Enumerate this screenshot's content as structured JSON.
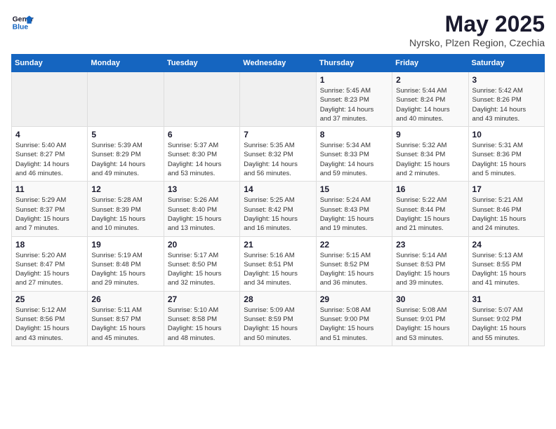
{
  "logo": {
    "line1": "General",
    "line2": "Blue"
  },
  "title": "May 2025",
  "subtitle": "Nyrsko, Plzen Region, Czechia",
  "weekdays": [
    "Sunday",
    "Monday",
    "Tuesday",
    "Wednesday",
    "Thursday",
    "Friday",
    "Saturday"
  ],
  "weeks": [
    [
      {
        "day": "",
        "info": ""
      },
      {
        "day": "",
        "info": ""
      },
      {
        "day": "",
        "info": ""
      },
      {
        "day": "",
        "info": ""
      },
      {
        "day": "1",
        "info": "Sunrise: 5:45 AM\nSunset: 8:23 PM\nDaylight: 14 hours\nand 37 minutes."
      },
      {
        "day": "2",
        "info": "Sunrise: 5:44 AM\nSunset: 8:24 PM\nDaylight: 14 hours\nand 40 minutes."
      },
      {
        "day": "3",
        "info": "Sunrise: 5:42 AM\nSunset: 8:26 PM\nDaylight: 14 hours\nand 43 minutes."
      }
    ],
    [
      {
        "day": "4",
        "info": "Sunrise: 5:40 AM\nSunset: 8:27 PM\nDaylight: 14 hours\nand 46 minutes."
      },
      {
        "day": "5",
        "info": "Sunrise: 5:39 AM\nSunset: 8:29 PM\nDaylight: 14 hours\nand 49 minutes."
      },
      {
        "day": "6",
        "info": "Sunrise: 5:37 AM\nSunset: 8:30 PM\nDaylight: 14 hours\nand 53 minutes."
      },
      {
        "day": "7",
        "info": "Sunrise: 5:35 AM\nSunset: 8:32 PM\nDaylight: 14 hours\nand 56 minutes."
      },
      {
        "day": "8",
        "info": "Sunrise: 5:34 AM\nSunset: 8:33 PM\nDaylight: 14 hours\nand 59 minutes."
      },
      {
        "day": "9",
        "info": "Sunrise: 5:32 AM\nSunset: 8:34 PM\nDaylight: 15 hours\nand 2 minutes."
      },
      {
        "day": "10",
        "info": "Sunrise: 5:31 AM\nSunset: 8:36 PM\nDaylight: 15 hours\nand 5 minutes."
      }
    ],
    [
      {
        "day": "11",
        "info": "Sunrise: 5:29 AM\nSunset: 8:37 PM\nDaylight: 15 hours\nand 7 minutes."
      },
      {
        "day": "12",
        "info": "Sunrise: 5:28 AM\nSunset: 8:39 PM\nDaylight: 15 hours\nand 10 minutes."
      },
      {
        "day": "13",
        "info": "Sunrise: 5:26 AM\nSunset: 8:40 PM\nDaylight: 15 hours\nand 13 minutes."
      },
      {
        "day": "14",
        "info": "Sunrise: 5:25 AM\nSunset: 8:42 PM\nDaylight: 15 hours\nand 16 minutes."
      },
      {
        "day": "15",
        "info": "Sunrise: 5:24 AM\nSunset: 8:43 PM\nDaylight: 15 hours\nand 19 minutes."
      },
      {
        "day": "16",
        "info": "Sunrise: 5:22 AM\nSunset: 8:44 PM\nDaylight: 15 hours\nand 21 minutes."
      },
      {
        "day": "17",
        "info": "Sunrise: 5:21 AM\nSunset: 8:46 PM\nDaylight: 15 hours\nand 24 minutes."
      }
    ],
    [
      {
        "day": "18",
        "info": "Sunrise: 5:20 AM\nSunset: 8:47 PM\nDaylight: 15 hours\nand 27 minutes."
      },
      {
        "day": "19",
        "info": "Sunrise: 5:19 AM\nSunset: 8:48 PM\nDaylight: 15 hours\nand 29 minutes."
      },
      {
        "day": "20",
        "info": "Sunrise: 5:17 AM\nSunset: 8:50 PM\nDaylight: 15 hours\nand 32 minutes."
      },
      {
        "day": "21",
        "info": "Sunrise: 5:16 AM\nSunset: 8:51 PM\nDaylight: 15 hours\nand 34 minutes."
      },
      {
        "day": "22",
        "info": "Sunrise: 5:15 AM\nSunset: 8:52 PM\nDaylight: 15 hours\nand 36 minutes."
      },
      {
        "day": "23",
        "info": "Sunrise: 5:14 AM\nSunset: 8:53 PM\nDaylight: 15 hours\nand 39 minutes."
      },
      {
        "day": "24",
        "info": "Sunrise: 5:13 AM\nSunset: 8:55 PM\nDaylight: 15 hours\nand 41 minutes."
      }
    ],
    [
      {
        "day": "25",
        "info": "Sunrise: 5:12 AM\nSunset: 8:56 PM\nDaylight: 15 hours\nand 43 minutes."
      },
      {
        "day": "26",
        "info": "Sunrise: 5:11 AM\nSunset: 8:57 PM\nDaylight: 15 hours\nand 45 minutes."
      },
      {
        "day": "27",
        "info": "Sunrise: 5:10 AM\nSunset: 8:58 PM\nDaylight: 15 hours\nand 48 minutes."
      },
      {
        "day": "28",
        "info": "Sunrise: 5:09 AM\nSunset: 8:59 PM\nDaylight: 15 hours\nand 50 minutes."
      },
      {
        "day": "29",
        "info": "Sunrise: 5:08 AM\nSunset: 9:00 PM\nDaylight: 15 hours\nand 51 minutes."
      },
      {
        "day": "30",
        "info": "Sunrise: 5:08 AM\nSunset: 9:01 PM\nDaylight: 15 hours\nand 53 minutes."
      },
      {
        "day": "31",
        "info": "Sunrise: 5:07 AM\nSunset: 9:02 PM\nDaylight: 15 hours\nand 55 minutes."
      }
    ]
  ]
}
